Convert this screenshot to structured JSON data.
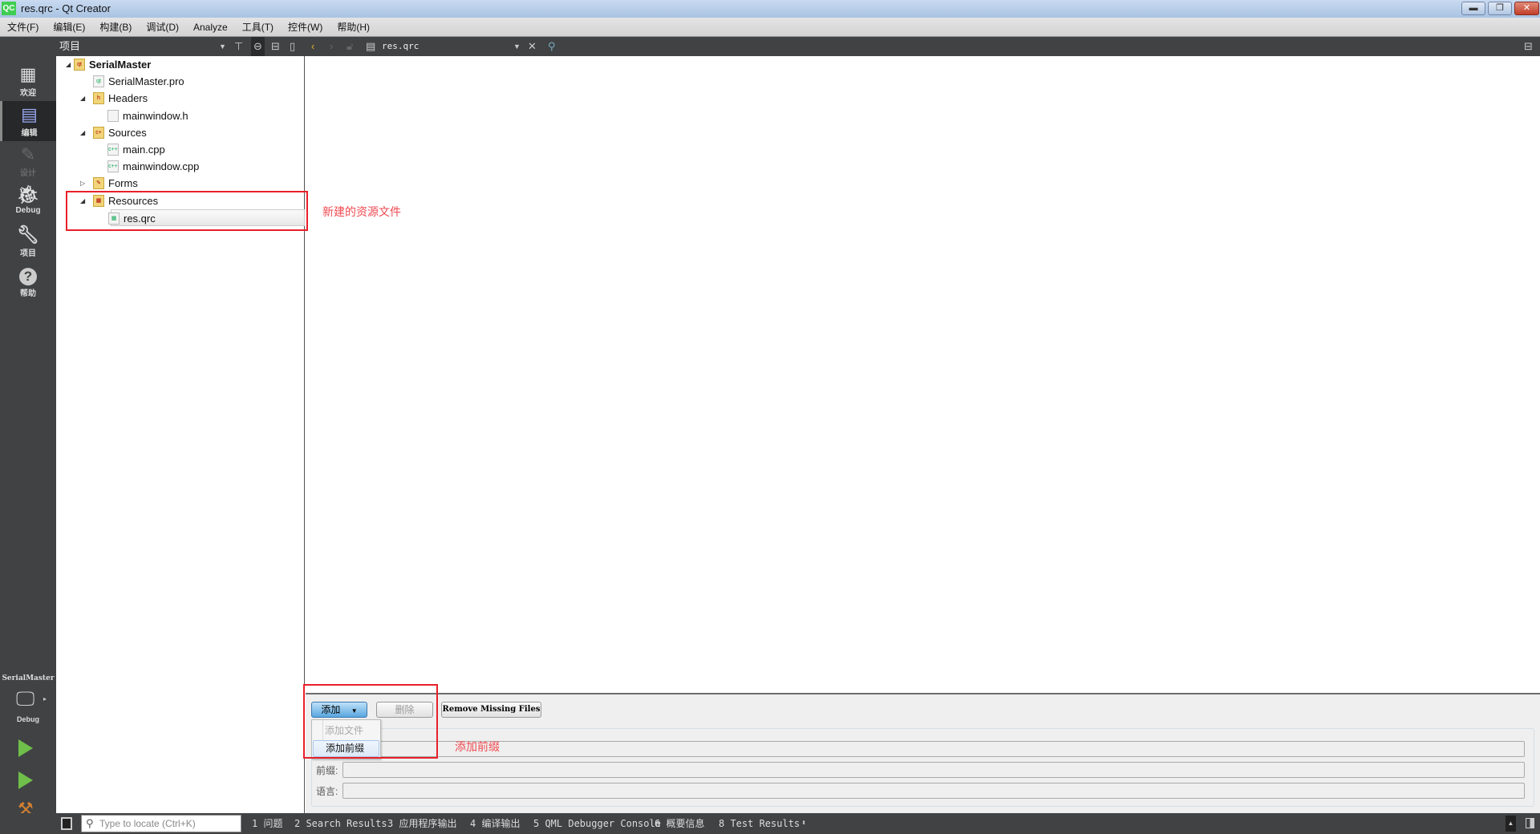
{
  "window": {
    "title": "res.qrc - Qt Creator",
    "logo": "QC",
    "controls": [
      "minimize",
      "restore",
      "close"
    ]
  },
  "menubar": [
    "文件(F)",
    "编辑(E)",
    "构建(B)",
    "调试(D)",
    "Analyze",
    "工具(T)",
    "控件(W)",
    "帮助(H)"
  ],
  "toolbar": {
    "panel_title": "项目",
    "open_file": "res.qrc",
    "icons": [
      "filter-icon",
      "link-icon",
      "split-icon",
      "close-panel-icon",
      "back-icon",
      "forward-icon",
      "lock-icon",
      "file-icon",
      "close-icon",
      "locator-icon",
      "split-editor-icon"
    ]
  },
  "modes": [
    {
      "label": "欢迎",
      "icon": "grid-icon"
    },
    {
      "label": "编辑",
      "icon": "edit-icon",
      "selected": true
    },
    {
      "label": "设计",
      "icon": "pencil-icon",
      "disabled": true
    },
    {
      "label": "Debug",
      "icon": "bug-icon"
    },
    {
      "label": "项目",
      "icon": "wrench-icon"
    },
    {
      "label": "帮助",
      "icon": "help-icon"
    }
  ],
  "target": {
    "project": "SerialMaster",
    "config": "Debug"
  },
  "tree": [
    {
      "label": "SerialMaster",
      "level": 0,
      "expanded": true,
      "bold": true,
      "icon": "qt-project-icon"
    },
    {
      "label": "SerialMaster.pro",
      "level": 1,
      "icon": "pro-file-icon"
    },
    {
      "label": "Headers",
      "level": 1,
      "expanded": true,
      "icon": "headers-folder-icon"
    },
    {
      "label": "mainwindow.h",
      "level": 2,
      "icon": "header-file-icon"
    },
    {
      "label": "Sources",
      "level": 1,
      "expanded": true,
      "icon": "sources-folder-icon"
    },
    {
      "label": "main.cpp",
      "level": 2,
      "icon": "cpp-file-icon"
    },
    {
      "label": "mainwindow.cpp",
      "level": 2,
      "icon": "cpp-file-icon"
    },
    {
      "label": "Forms",
      "level": 1,
      "expanded": false,
      "icon": "forms-folder-icon"
    },
    {
      "label": "Resources",
      "level": 1,
      "expanded": true,
      "icon": "resources-folder-icon"
    },
    {
      "label": "res.qrc",
      "level": 2,
      "selected": true,
      "icon": "qrc-file-icon"
    }
  ],
  "annotations": {
    "tree": "新建的资源文件",
    "menu": "添加前缀",
    "color": "#e8202a"
  },
  "resource_editor": {
    "add_button": "添加",
    "remove_button": "删除",
    "remove_missing_button": "Remove Missing Files",
    "add_menu": [
      {
        "label": "添加文件",
        "disabled": true
      },
      {
        "label": "添加前缀",
        "highlighted": true
      }
    ],
    "fields": {
      "prefix_label": "前缀:",
      "language_label": "语言:",
      "prefix_value": "",
      "language_value": ""
    }
  },
  "statusbar": {
    "locate_placeholder": "Type to locate (Ctrl+K)",
    "tabs": [
      "1 问题",
      "2 Search Results",
      "3 应用程序输出",
      "4 编译输出",
      "5 QML Debugger Console",
      "6 概要信息",
      "8 Test Results"
    ]
  }
}
